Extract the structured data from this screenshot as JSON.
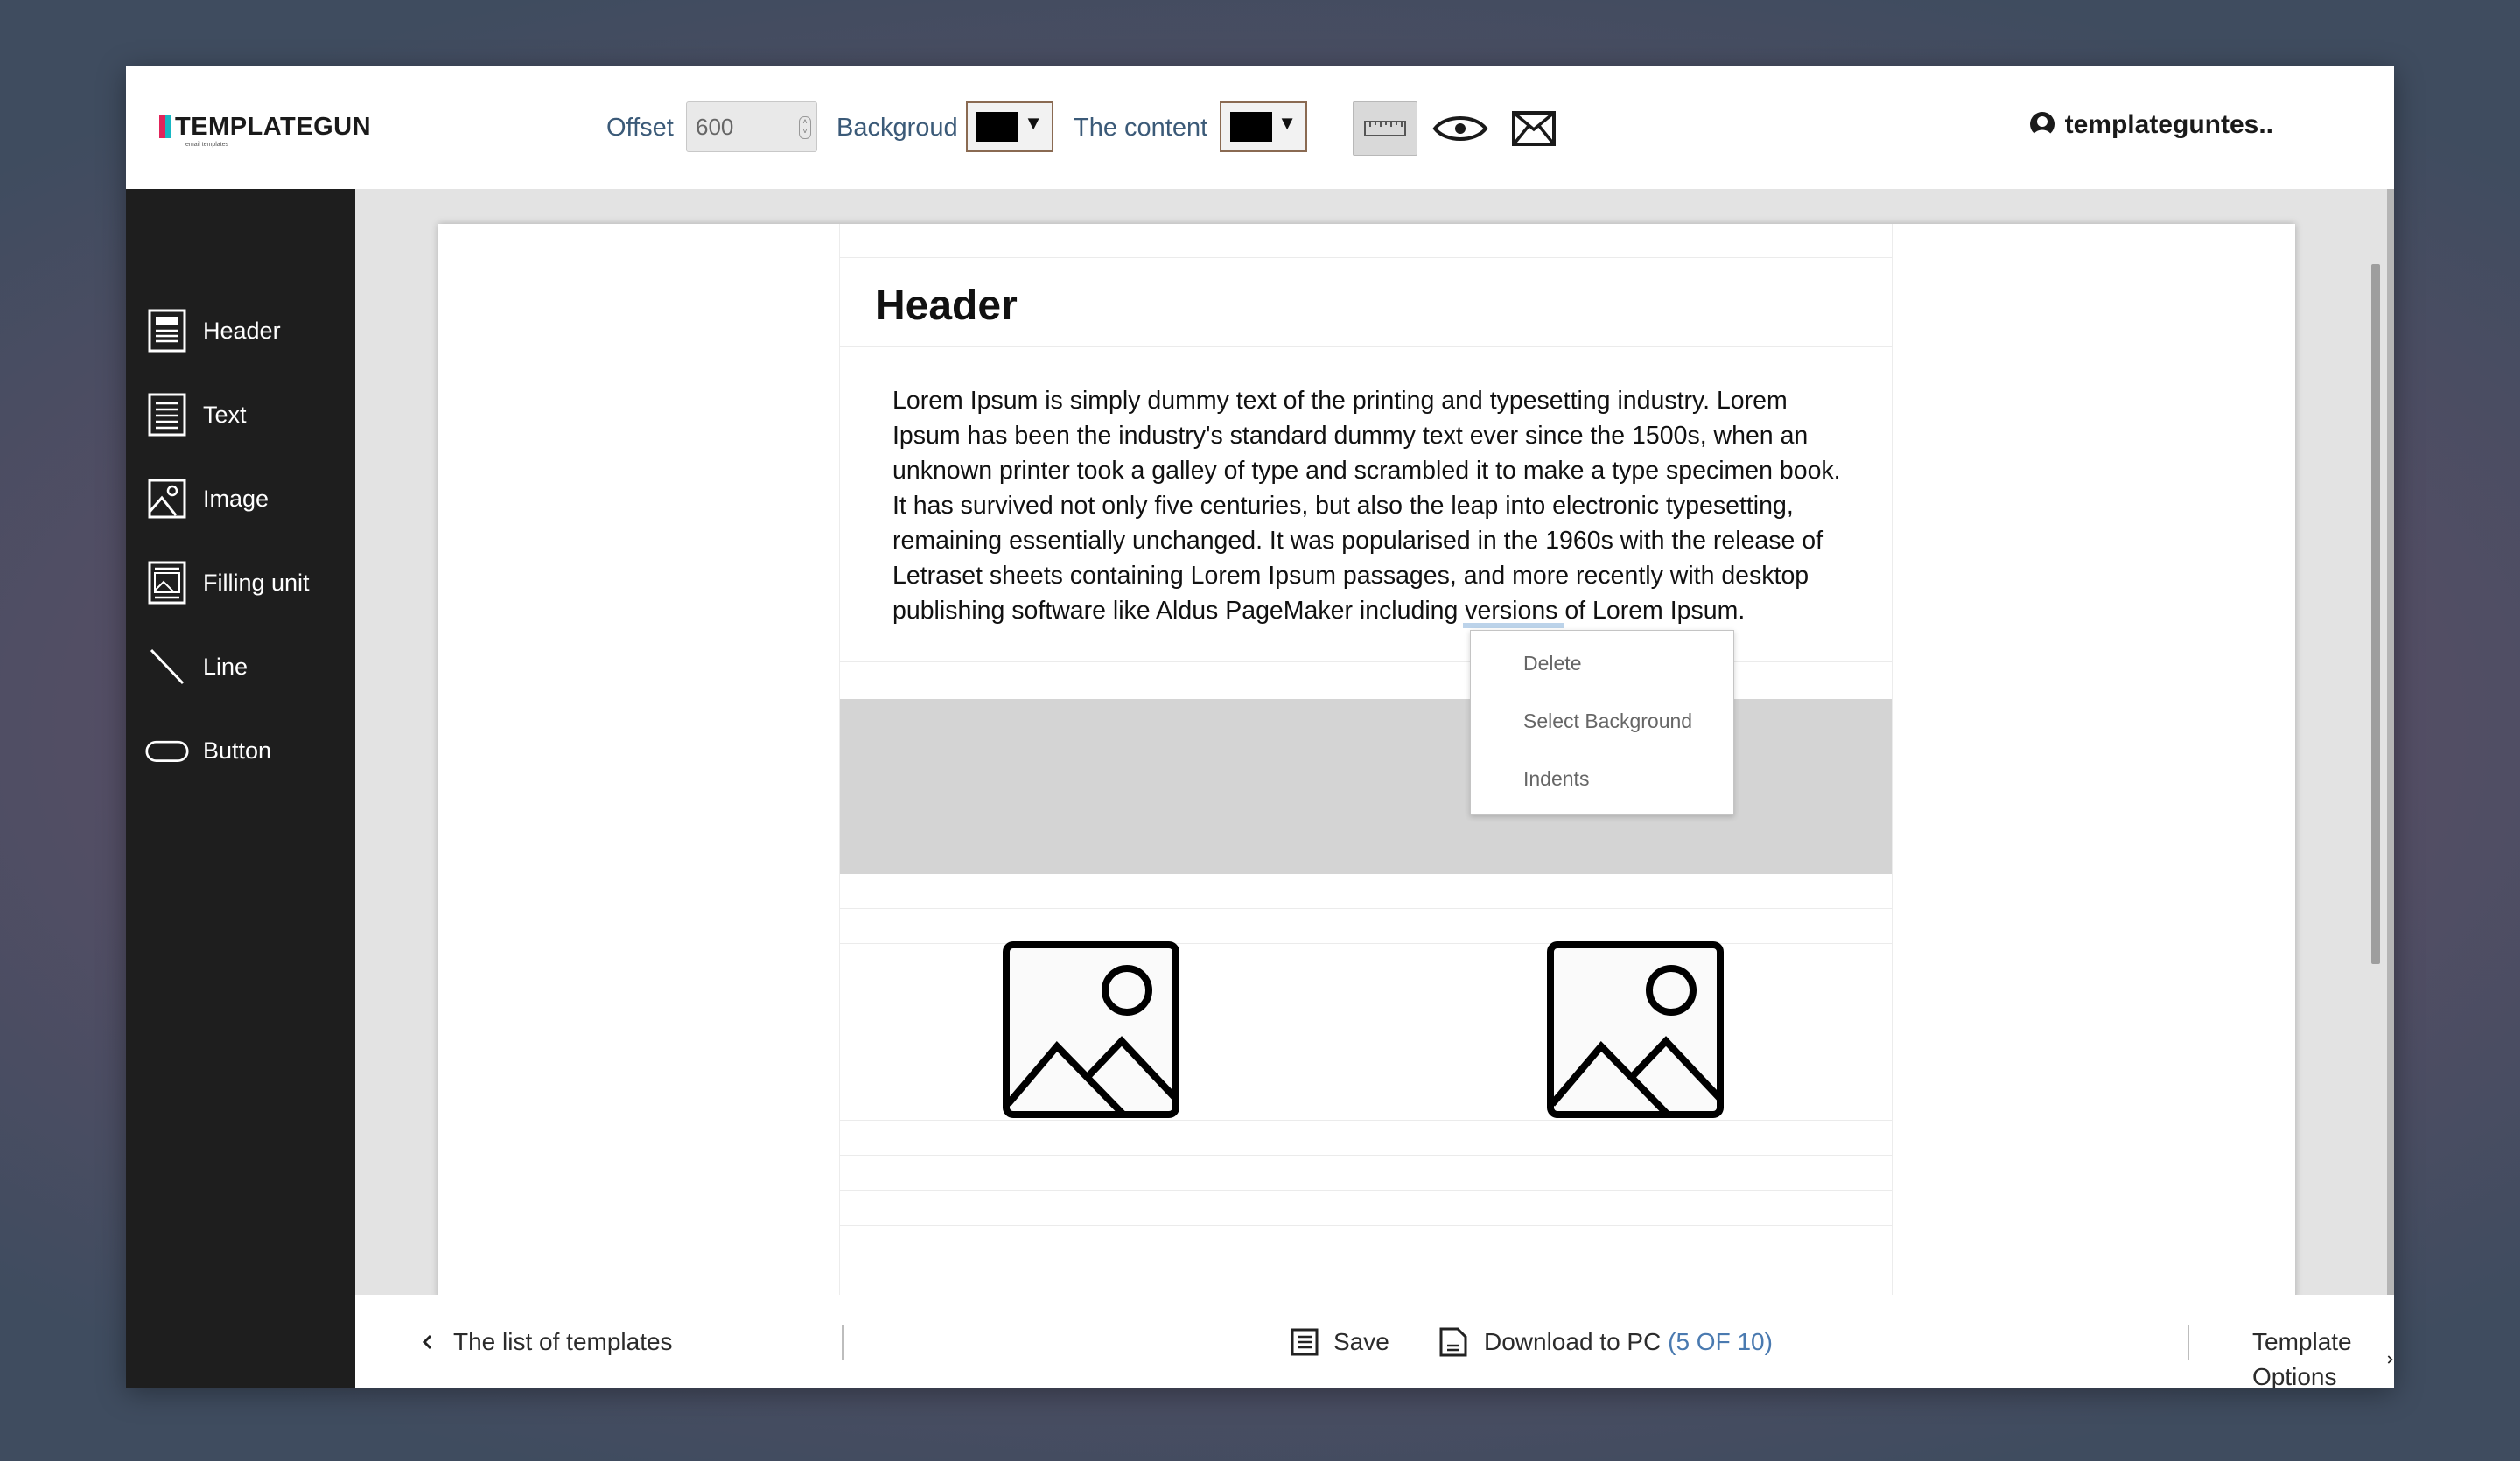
{
  "brand": {
    "name": "TEMPLATEGUN",
    "tagline": "email templates",
    "colors": [
      "#e2245a",
      "#18b7c4"
    ]
  },
  "toolbar": {
    "offset_label": "Offset",
    "offset_value": "600",
    "background_label": "Backgroud",
    "background_color": "#000000",
    "content_label": "The content",
    "content_color": "#000000",
    "tools": [
      "ruler-icon",
      "eye-icon",
      "envelope-icon"
    ]
  },
  "user": {
    "name": "templateguntes.."
  },
  "sidebar": {
    "items": [
      {
        "label": "Header",
        "icon": "header-block-icon"
      },
      {
        "label": "Text",
        "icon": "text-block-icon"
      },
      {
        "label": "Image",
        "icon": "image-block-icon"
      },
      {
        "label": "Filling unit",
        "icon": "filling-unit-icon"
      },
      {
        "label": "Line",
        "icon": "line-icon"
      },
      {
        "label": "Button",
        "icon": "button-icon"
      }
    ]
  },
  "document": {
    "header": "Header",
    "text_lines": [
      "Lorem Ipsum is simply dummy text of the printing and typesetting industry. Lorem",
      "Ipsum has been the industry's standard dummy text ever since the 1500s, when an",
      "unknown printer took a galley of type and scrambled it to make a type specimen book.",
      "It has survived not only five centuries, but also the leap into electronic typesetting,",
      "remaining essentially unchanged. It was popularised in the 1960s with the release of",
      "Letraset sheets containing Lorem Ipsum passages, and more recently with desktop",
      "publishing software like Aldus PageMaker including versions of Lorem Ipsum."
    ]
  },
  "context_menu": {
    "items": [
      "Delete",
      "Select Background",
      "Indents"
    ]
  },
  "bottom": {
    "templates_link": "The list of templates",
    "save_label": "Save",
    "download_label": "Download to PC",
    "download_count": "(5 OF 10)",
    "options_label": "Template Options"
  }
}
